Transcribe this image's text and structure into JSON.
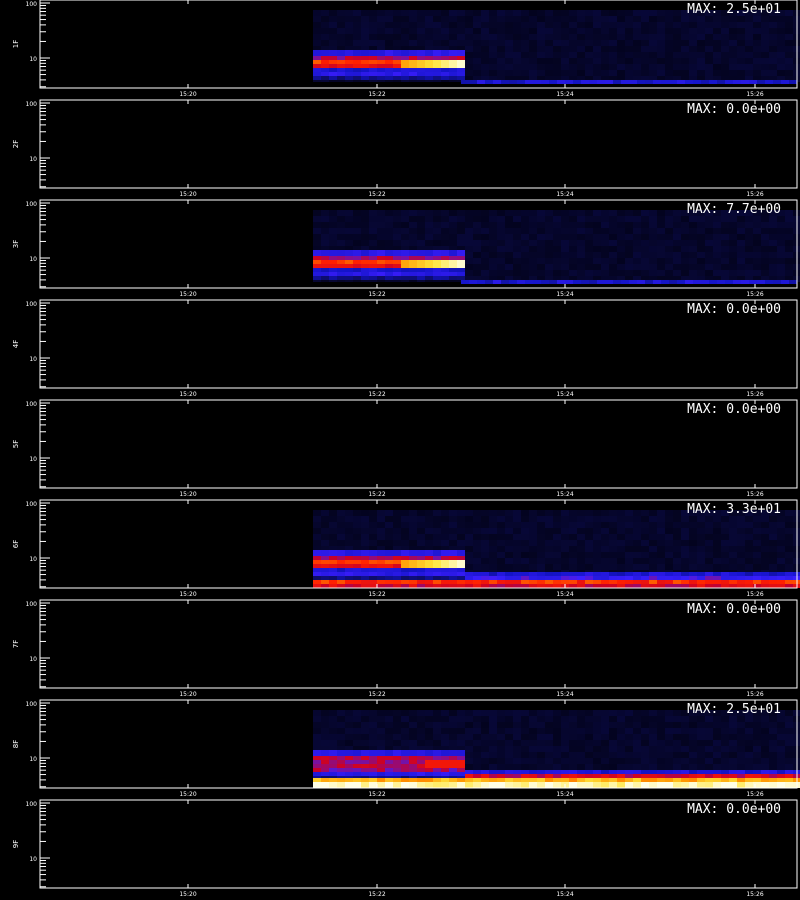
{
  "chart_data": {
    "type": "heatmap",
    "x_ticks": [
      "15:20",
      "15:22",
      "15:24",
      "15:26"
    ],
    "y_ticks": [
      "10",
      "100"
    ],
    "y_scale": "log",
    "panels": [
      {
        "ylabel": "1F",
        "max_label": "MAX: 2.5e+01",
        "max": 25,
        "pattern": "A"
      },
      {
        "ylabel": "2F",
        "max_label": "MAX: 0.0e+00",
        "max": 0,
        "pattern": "none"
      },
      {
        "ylabel": "3F",
        "max_label": "MAX: 7.7e+00",
        "max": 7.7,
        "pattern": "A"
      },
      {
        "ylabel": "4F",
        "max_label": "MAX: 0.0e+00",
        "max": 0,
        "pattern": "none"
      },
      {
        "ylabel": "5F",
        "max_label": "MAX: 0.0e+00",
        "max": 0,
        "pattern": "none"
      },
      {
        "ylabel": "6F",
        "max_label": "MAX: 3.3e+01",
        "max": 33,
        "pattern": "B"
      },
      {
        "ylabel": "7F",
        "max_label": "MAX: 0.0e+00",
        "max": 0,
        "pattern": "none"
      },
      {
        "ylabel": "8F",
        "max_label": "MAX: 2.5e+01",
        "max": 25,
        "pattern": "C"
      },
      {
        "ylabel": "9F",
        "max_label": "MAX: 0.0e+00",
        "max": 0,
        "pattern": "none"
      }
    ]
  }
}
